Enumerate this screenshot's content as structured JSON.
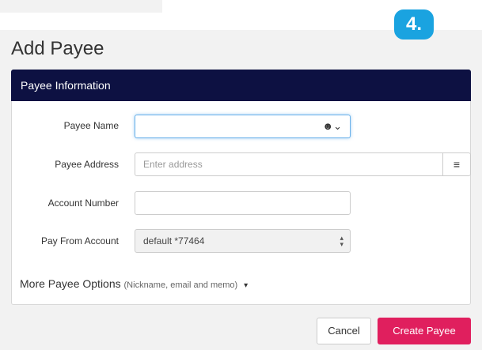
{
  "step_badge": "4.",
  "page_title": "Add Payee",
  "panel": {
    "header": "Payee Information"
  },
  "form": {
    "payee_name": {
      "label": "Payee Name",
      "value": "",
      "icon": "contact-person-icon",
      "icon_glyph": "☻⌄"
    },
    "payee_address": {
      "label": "Payee Address",
      "placeholder": "Enter address",
      "icon": "list-icon",
      "icon_glyph": "≡"
    },
    "account_number": {
      "label": "Account Number",
      "value": ""
    },
    "pay_from_account": {
      "label": "Pay From Account",
      "selected": "default *77464"
    }
  },
  "more_options": {
    "label": "More Payee Options",
    "hint": "(Nickname, email and memo)",
    "caret": "▾"
  },
  "buttons": {
    "cancel": "Cancel",
    "create": "Create Payee"
  },
  "colors": {
    "header_bg": "#0d1142",
    "primary_button": "#e01f5e",
    "badge": "#1aa3e0"
  }
}
